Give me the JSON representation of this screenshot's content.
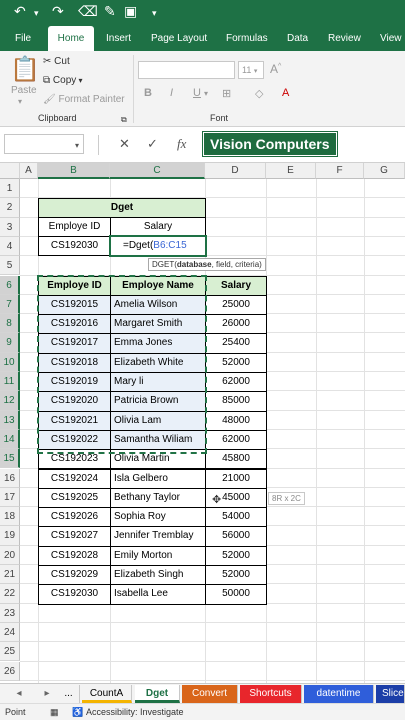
{
  "ribbon_tabs": [
    "File",
    "Home",
    "Insert",
    "Page Layout",
    "Formulas",
    "Data",
    "Review",
    "View"
  ],
  "clipboard": {
    "paste": "Paste",
    "cut": "Cut",
    "copy": "Copy",
    "format_painter": "Format Painter",
    "group": "Clipboard"
  },
  "font": {
    "size": "11",
    "group": "Font",
    "bold": "B",
    "italic": "I",
    "underline": "U"
  },
  "formula_bar": {
    "cancel": "✕",
    "enter": "✓",
    "fx": "fx",
    "overlay": "Vision Computers"
  },
  "columns": [
    "A",
    "B",
    "C",
    "D",
    "E",
    "F",
    "G"
  ],
  "rows": [
    "1",
    "2",
    "3",
    "4",
    "5",
    "6",
    "7",
    "8",
    "9",
    "10",
    "11",
    "12",
    "13",
    "14",
    "15",
    "16",
    "17",
    "18",
    "19",
    "20",
    "21",
    "22",
    "23",
    "24",
    "25",
    "26"
  ],
  "criteria": {
    "title": "Dget",
    "col1": "Employe ID",
    "col2": "Salary",
    "id": "CS192030",
    "formula_prefix": "=Dget(",
    "formula_ref": "B6:C15"
  },
  "tooltip": {
    "fn": "DGET(",
    "arg1": "database",
    ", rest": "",
    "rest": ", field, criteria)"
  },
  "table": {
    "headers": [
      "Employe ID",
      "Employe Name",
      "Salary"
    ],
    "rows": [
      [
        "CS192015",
        "Amelia Wilson",
        "25000"
      ],
      [
        "CS192016",
        "Margaret Smith",
        "26000"
      ],
      [
        "CS192017",
        "Emma Jones",
        "25400"
      ],
      [
        "CS192018",
        "Elizabeth White",
        "52000"
      ],
      [
        "CS192019",
        "Mary li",
        "62000"
      ],
      [
        "CS192020",
        "Patricia Brown",
        "85000"
      ],
      [
        "CS192021",
        "Olivia Lam",
        "48000"
      ],
      [
        "CS192022",
        "Samantha Wiliam",
        "62000"
      ],
      [
        "CS192023",
        "Olivia Martin",
        "45800"
      ],
      [
        "CS192024",
        "Isla Gelbero",
        "21000"
      ],
      [
        "CS192025",
        "Bethany Taylor",
        "45000"
      ],
      [
        "CS192026",
        "Sophia Roy",
        "54000"
      ],
      [
        "CS192027",
        "Jennifer Tremblay",
        "56000"
      ],
      [
        "CS192028",
        "Emily Morton",
        "52000"
      ],
      [
        "CS192029",
        "Elizabeth Singh",
        "52000"
      ],
      [
        "CS192030",
        "Isabella Lee",
        "50000"
      ]
    ]
  },
  "size_tip": "8R x 2C",
  "sheet_tabs": [
    "...",
    "CountA",
    "Dget",
    "Convert",
    "Shortcuts",
    "datentime",
    "Slice"
  ],
  "sheet_colors": {
    "CountA": "#f4b400",
    "Dget": "#ffffff",
    "Convert": "#d9651a",
    "Shortcuts": "#e8262c",
    "datentime": "#2f5eda",
    "Slice": "#1c3ea8"
  },
  "status": {
    "mode": "Point",
    "accessibility": "Accessibility: Investigate"
  }
}
